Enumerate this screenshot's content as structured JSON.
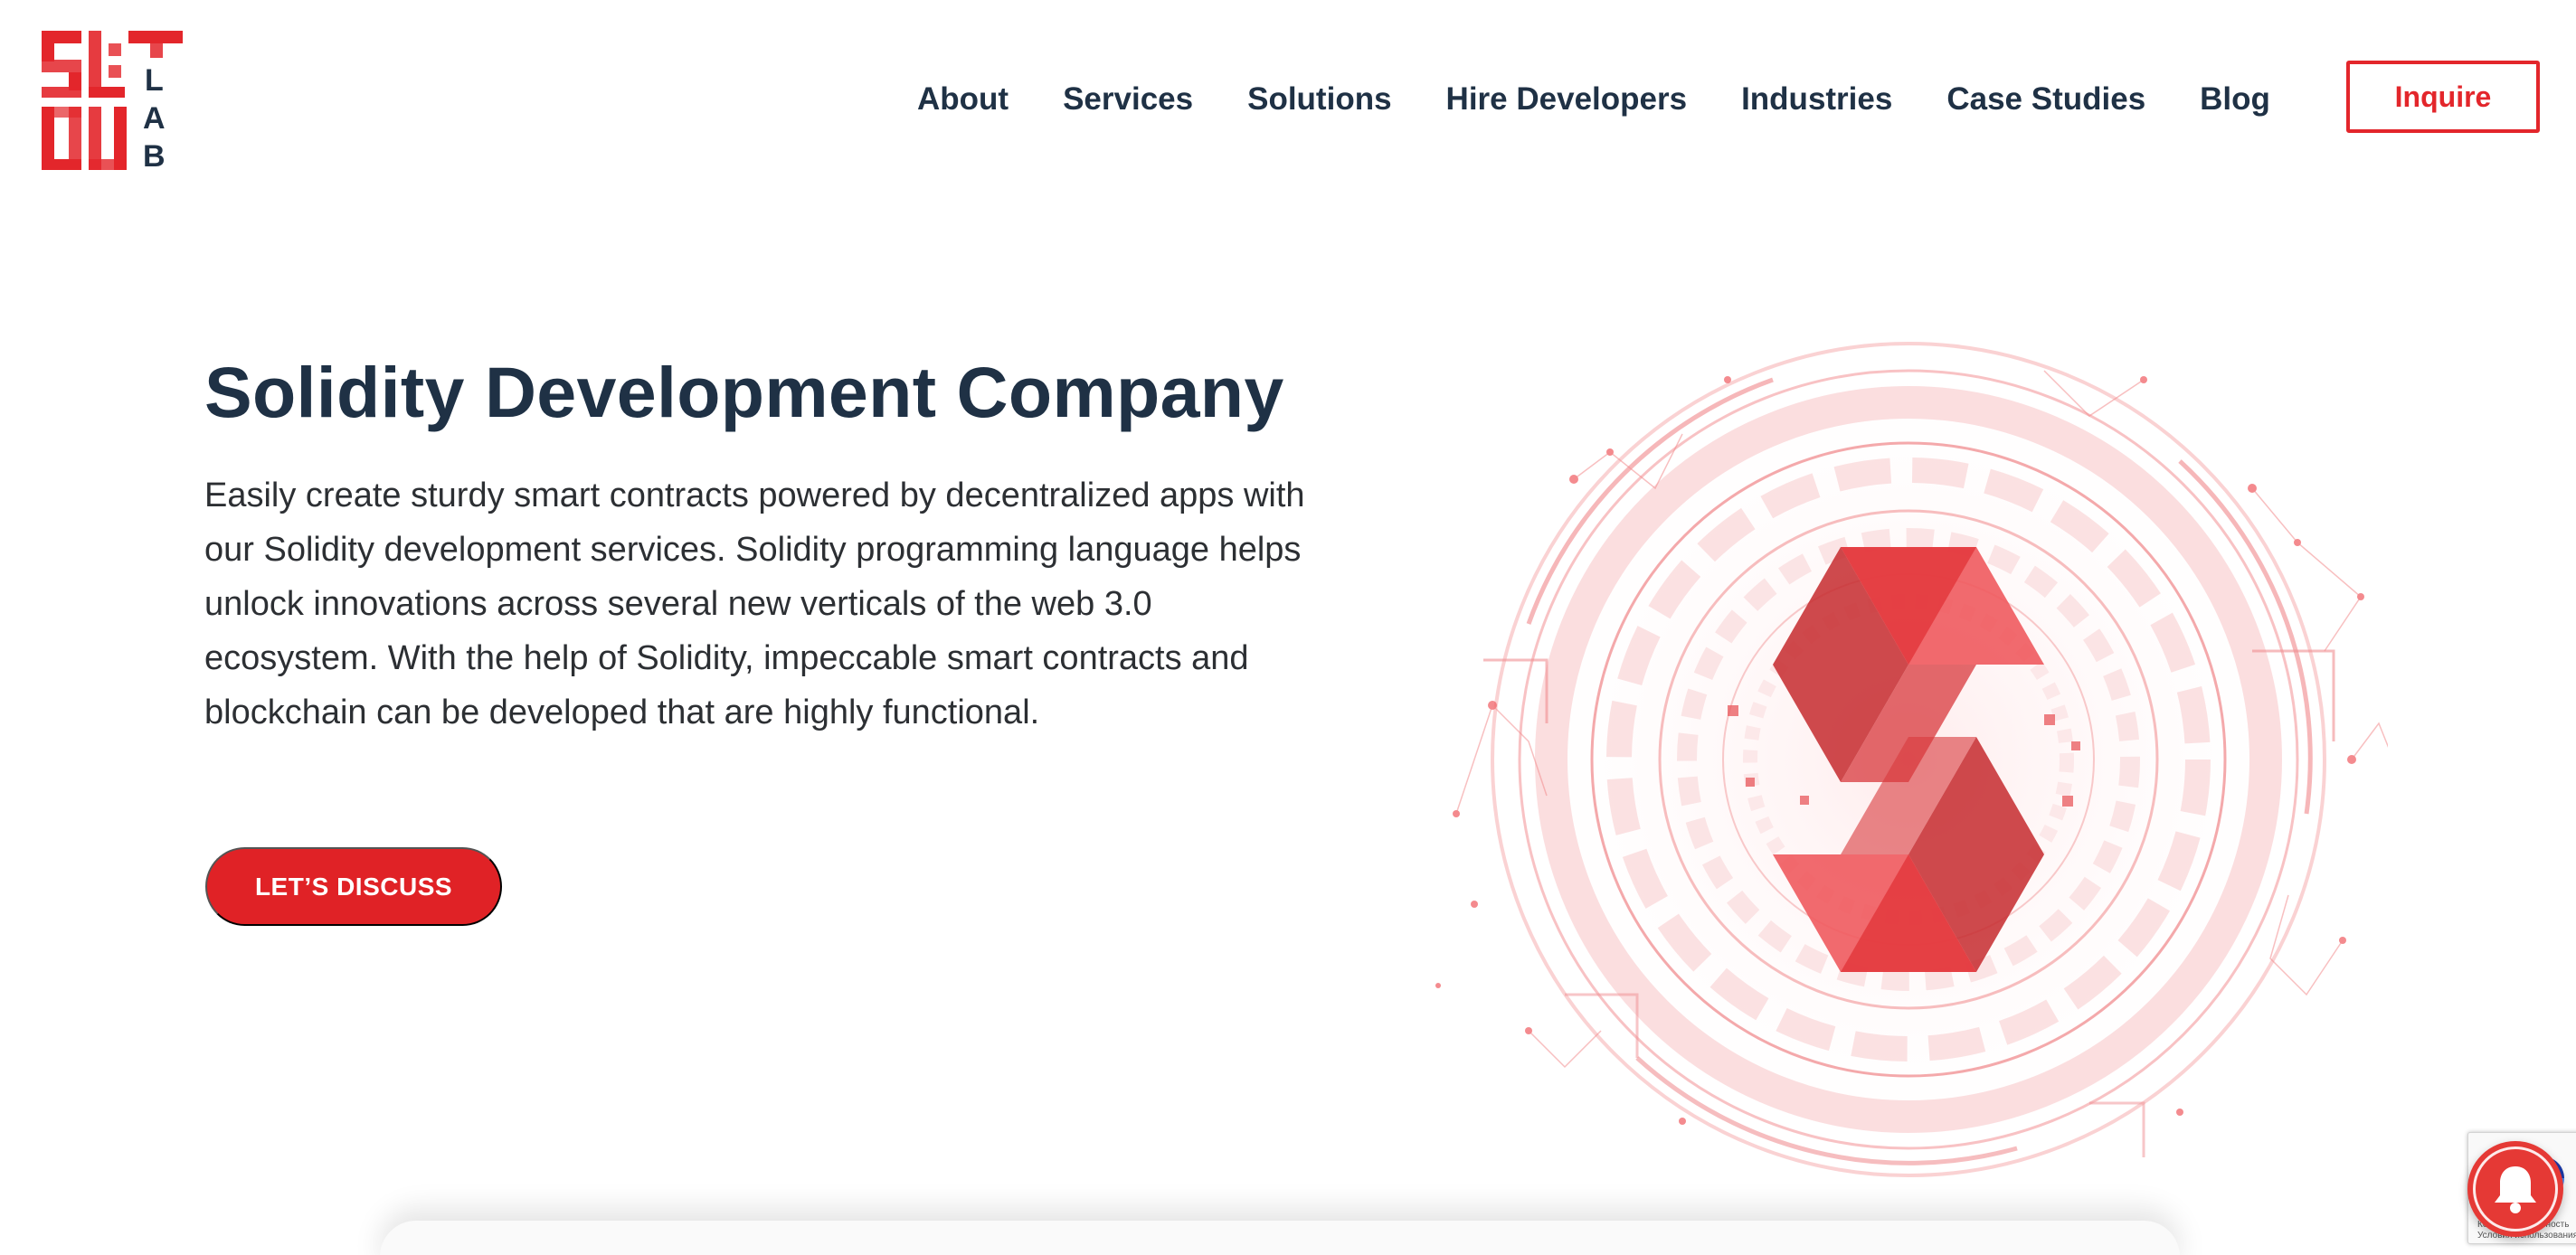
{
  "header": {
    "logo_alt": "SLOU LAB",
    "logo_letters": [
      "L",
      "A",
      "B"
    ],
    "nav": [
      {
        "label": "About"
      },
      {
        "label": "Services"
      },
      {
        "label": "Solutions"
      },
      {
        "label": "Hire Developers"
      },
      {
        "label": "Industries"
      },
      {
        "label": "Case Studies"
      },
      {
        "label": "Blog"
      }
    ],
    "inquire_label": "Inquire"
  },
  "hero": {
    "title": "Solidity Development Company",
    "description": "Easily create sturdy smart contracts powered by decentralized apps with our Solidity development services. Solidity programming language helps unlock innovations across several new verticals of the web 3.0 ecosystem. With the help of Solidity, impeccable smart contracts and blockchain can be developed that are highly functional.",
    "cta_label": "LET’S DISCUSS"
  },
  "recaptcha": {
    "text_line1": "Конфиденциальность",
    "text_line2": "Условия использования"
  },
  "colors": {
    "brand_red": "#e3262b",
    "navy": "#1f3145",
    "text": "#2c2f33"
  },
  "icons": {
    "logo": "slou-lab-logo",
    "hero": "solidity-network-illustration",
    "notification": "bell-icon",
    "recaptcha": "recaptcha-icon"
  }
}
